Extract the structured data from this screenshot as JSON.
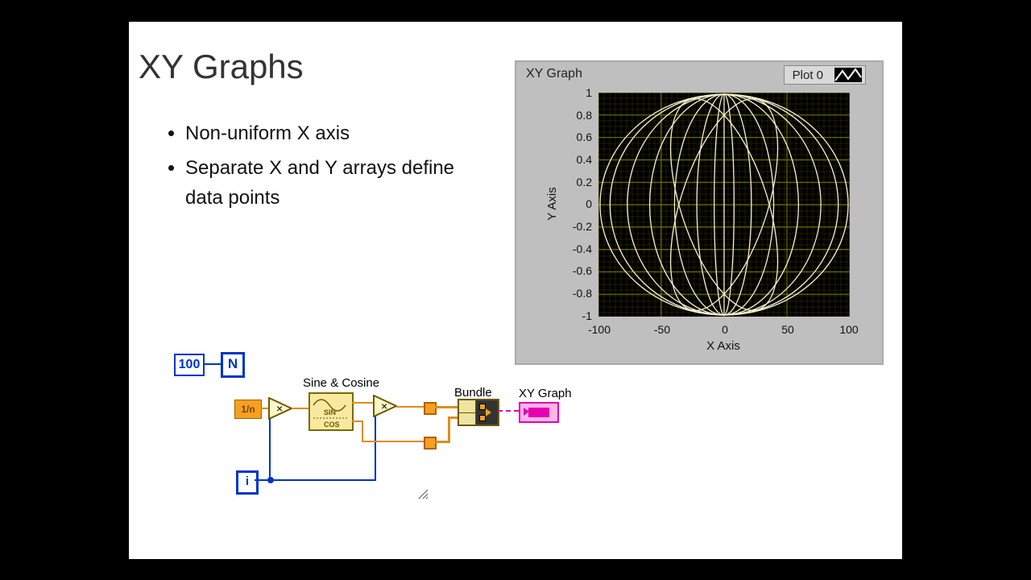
{
  "title": "XY Graphs",
  "bullets": [
    "Non-uniform X axis",
    "Separate X and Y arrays define data points"
  ],
  "graph": {
    "panel_title": "XY Graph",
    "legend_label": "Plot 0",
    "ylabel": "Y Axis",
    "xlabel": "X Axis",
    "yticks": [
      "1",
      "0.8",
      "0.6",
      "0.4",
      "0.2",
      "0",
      "-0.2",
      "-0.4",
      "-0.6",
      "-0.8",
      "-1"
    ],
    "xticks": [
      "-100",
      "-50",
      "0",
      "50",
      "100"
    ]
  },
  "bd": {
    "const100": "100",
    "N": "N",
    "i": "i",
    "oneoverN": "1/n",
    "sincos_label": "Sine & Cosine",
    "bundle_label": "Bundle",
    "xygraph_label": "XY Graph"
  },
  "chart_data": {
    "type": "line",
    "note": "XY graph visually depicts ~10 overlapping Lissajous-style curves forming a sphere/globe outline; exact series values are not labeled on the image.",
    "xlabel": "X Axis",
    "ylabel": "Y Axis",
    "xlim": [
      -100,
      100
    ],
    "ylim": [
      -1,
      1
    ],
    "series_count_estimate": 10
  }
}
